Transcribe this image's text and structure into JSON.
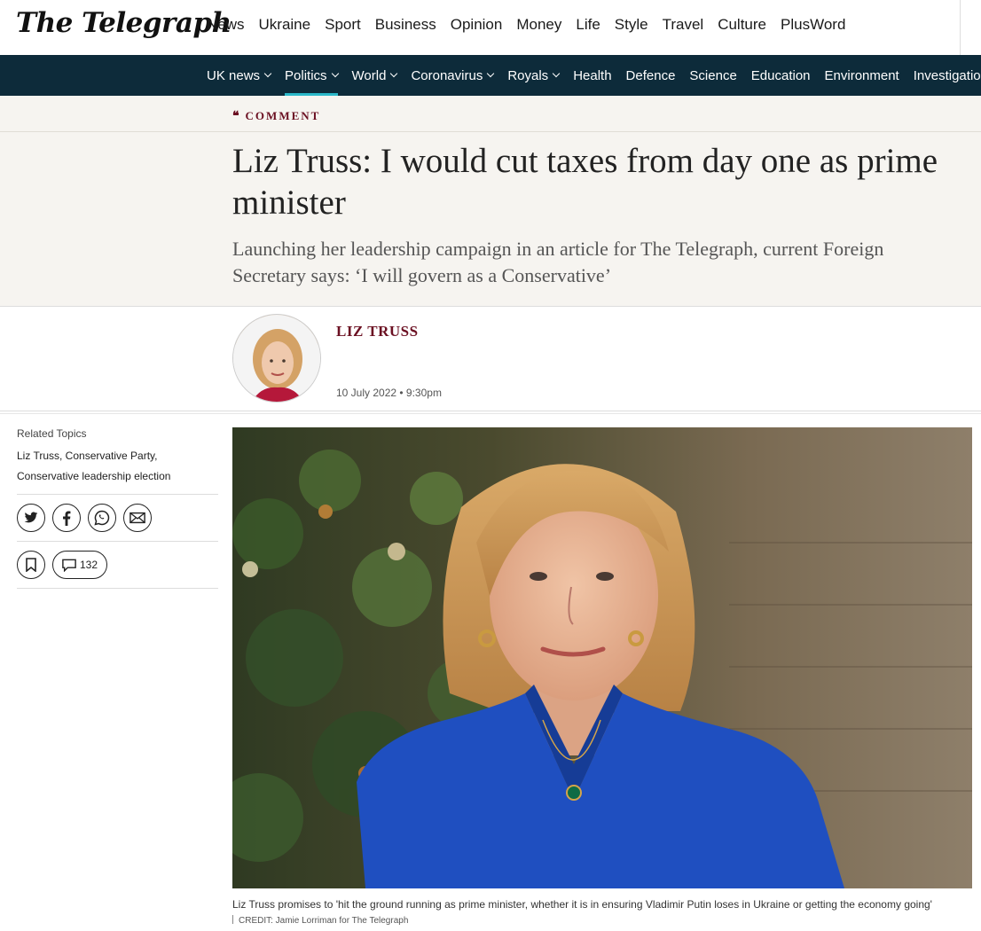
{
  "brand": {
    "logo_text": "The Telegraph"
  },
  "primary_nav": [
    "News",
    "Ukraine",
    "Sport",
    "Business",
    "Opinion",
    "Money",
    "Life",
    "Style",
    "Travel",
    "Culture",
    "PlusWord"
  ],
  "secondary_nav": [
    {
      "label": "UK news",
      "has_dropdown": true,
      "active": false
    },
    {
      "label": "Politics",
      "has_dropdown": true,
      "active": true
    },
    {
      "label": "World",
      "has_dropdown": true,
      "active": false
    },
    {
      "label": "Coronavirus",
      "has_dropdown": true,
      "active": false
    },
    {
      "label": "Royals",
      "has_dropdown": true,
      "active": false
    },
    {
      "label": "Health",
      "has_dropdown": false,
      "active": false
    },
    {
      "label": "Defence",
      "has_dropdown": false,
      "active": false
    },
    {
      "label": "Science",
      "has_dropdown": false,
      "active": false
    },
    {
      "label": "Education",
      "has_dropdown": false,
      "active": false
    },
    {
      "label": "Environment",
      "has_dropdown": false,
      "active": false
    },
    {
      "label": "Investigations",
      "has_dropdown": false,
      "active": false
    }
  ],
  "article": {
    "kicker": "COMMENT",
    "headline": "Liz Truss: I would cut taxes from day one as prime minister",
    "standfirst": "Launching her leadership campaign in an article for The Telegraph, current Foreign Secretary says: ‘I will govern as a Conservative’",
    "author": "LIZ TRUSS",
    "published": "10 July 2022 • 9:30pm"
  },
  "sidebar": {
    "related_title": "Related Topics",
    "related_links_line1": "Liz Truss, Conservative Party,",
    "related_links_line2": "Conservative leadership election",
    "comment_count": "132"
  },
  "image": {
    "caption": "Liz Truss promises to 'hit the ground running as prime minister, whether it is in ensuring Vladimir Putin loses in Ukraine or getting the economy going'",
    "credit": "CREDIT: Jamie Lorriman for The Telegraph"
  },
  "colors": {
    "nav_background": "#0d2b3a",
    "active_underline": "#2bb8c9",
    "accent_burgundy": "#6b1022",
    "band_background": "#f6f4f0"
  },
  "icons": [
    "twitter-icon",
    "facebook-icon",
    "whatsapp-icon",
    "email-icon",
    "bookmark-icon",
    "comment-icon",
    "quote-icon",
    "chevron-down-icon"
  ]
}
